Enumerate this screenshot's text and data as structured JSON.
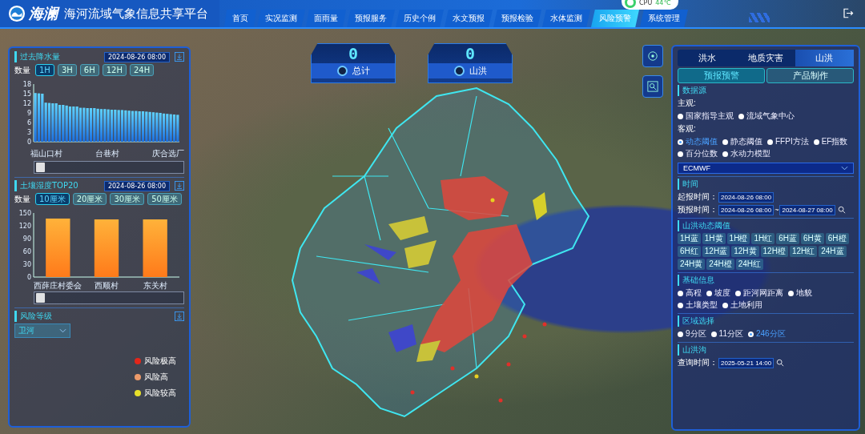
{
  "header": {
    "logo_text": "海澜",
    "title": "海河流域气象信息共享平台",
    "nav": [
      {
        "label": "首页",
        "selected": false
      },
      {
        "label": "实况监测",
        "selected": false
      },
      {
        "label": "面雨量",
        "selected": false
      },
      {
        "label": "预报服务",
        "selected": false
      },
      {
        "label": "历史个例",
        "selected": false
      },
      {
        "label": "水文预报",
        "selected": false
      },
      {
        "label": "预报检验",
        "selected": false
      },
      {
        "label": "水体监测",
        "selected": false
      },
      {
        "label": "风险预警",
        "selected": true
      },
      {
        "label": "系统管理",
        "selected": false
      }
    ]
  },
  "system_monitor": {
    "cpu_label": "CPU",
    "cpu_temp": "44℃"
  },
  "left_panel": {
    "precipitation": {
      "title": "过去降水量",
      "time": "2024-08-26 08:00",
      "ranges": [
        {
          "label": "1H",
          "selected": true
        },
        {
          "label": "3H",
          "selected": false
        },
        {
          "label": "6H",
          "selected": false
        },
        {
          "label": "12H",
          "selected": false
        },
        {
          "label": "24H",
          "selected": false
        }
      ],
      "station_labels": [
        "福山口村",
        "台巷村",
        "庆合选厂"
      ],
      "zoom": {
        "level": 0.06
      },
      "chart_data": {
        "type": "bar",
        "ylabel": "数量",
        "ylim": [
          0,
          18
        ],
        "yticks": [
          0,
          3,
          6,
          9,
          12,
          15,
          18
        ],
        "values": [
          15.2,
          15.1,
          15,
          12.2,
          12.1,
          12,
          12,
          11.5,
          11.5,
          11.3,
          11,
          11,
          11,
          10.6,
          10.6,
          10.5,
          10.5,
          10.5,
          10.3,
          10.2,
          10.2,
          10.1,
          10,
          10,
          9.9,
          9.9,
          9.8,
          9.7,
          9.6,
          9.6,
          9.5,
          9.5,
          9.4,
          9.3,
          9.2,
          9.1,
          9,
          8.8,
          8.7,
          8.6,
          8.5,
          8.4
        ]
      }
    },
    "soil": {
      "title": "土壤湿度TOP20",
      "time": "2024-08-26 08:00",
      "ranges": [
        {
          "label": "10厘米",
          "selected": true
        },
        {
          "label": "20厘米",
          "selected": false
        },
        {
          "label": "30厘米",
          "selected": false
        },
        {
          "label": "50厘米",
          "selected": false
        }
      ],
      "zoom": {
        "level": 0.06
      },
      "chart_data": {
        "type": "bar",
        "ylabel": "数量",
        "ylim": [
          0,
          150
        ],
        "yticks": [
          0,
          30,
          60,
          90,
          120,
          150
        ],
        "categories": [
          "西薛庄村委会",
          "西顺村",
          "东关村"
        ],
        "values": [
          137,
          135,
          135
        ]
      }
    },
    "risk": {
      "title": "风险等级",
      "basin": "卫河",
      "legend": [
        {
          "label": "风险极高",
          "color": "#e3261a"
        },
        {
          "label": "风险高",
          "color": "#ec9a6a"
        },
        {
          "label": "风险较高",
          "color": "#e8e02a"
        }
      ]
    }
  },
  "stats": [
    {
      "value": "0",
      "label": "总计"
    },
    {
      "value": "0",
      "label": "山洪"
    }
  ],
  "right_panel": {
    "tabs": [
      {
        "label": "洪水",
        "selected": false
      },
      {
        "label": "地质灾害",
        "selected": false
      },
      {
        "label": "山洪",
        "selected": true
      }
    ],
    "subtabs": [
      {
        "label": "预报预警",
        "selected": true
      },
      {
        "label": "产品制作",
        "selected": false
      }
    ],
    "data_source": {
      "title": "数据源",
      "groups": [
        {
          "label": "主观:",
          "options": [
            {
              "label": "国家指导主观",
              "selected": false
            },
            {
              "label": "流域气象中心",
              "selected": false
            }
          ]
        },
        {
          "label": "客观:",
          "options": [
            {
              "label": "动态阈值",
              "selected": true
            },
            {
              "label": "静态阈值",
              "selected": false
            },
            {
              "label": "FFPI方法",
              "selected": false
            },
            {
              "label": "EF指数",
              "selected": false
            },
            {
              "label": "百分位数",
              "selected": false
            },
            {
              "label": "水动力模型",
              "selected": false
            }
          ]
        }
      ],
      "model": "ECMWF"
    },
    "time": {
      "title": "时间",
      "start_label": "起报时间：",
      "start": "2024-08-26 08:00",
      "forecast_label": "预报时间：",
      "forecast_from": "2024-08-26 08:00",
      "separator": "~",
      "forecast_to": "2024-08-27 08:00"
    },
    "thresholds": {
      "title": "山洪动态阈值",
      "tags": [
        "1H蓝",
        "1H黄",
        "1H橙",
        "1H红",
        "6H蓝",
        "6H黄",
        "6H橙",
        "6H红",
        "12H蓝",
        "12H黄",
        "12H橙",
        "12H红",
        "24H蓝",
        "24H黄",
        "24H橙",
        "24H红"
      ]
    },
    "base_info": {
      "title": "基础信息",
      "items": [
        {
          "label": "高程",
          "checked": false
        },
        {
          "label": "坡度",
          "checked": false
        },
        {
          "label": "距河网距离",
          "checked": false
        },
        {
          "label": "地貌",
          "checked": false
        },
        {
          "label": "土壤类型",
          "checked": false
        },
        {
          "label": "土地利用",
          "checked": false
        }
      ]
    },
    "region": {
      "title": "区域选择",
      "options": [
        {
          "label": "9分区",
          "selected": false
        },
        {
          "label": "11分区",
          "selected": false
        },
        {
          "label": "246分区",
          "selected": true
        }
      ]
    },
    "gully": {
      "title": "山洪沟",
      "query_label": "查询时间：",
      "query_time": "2025-05-21 14:00"
    }
  }
}
